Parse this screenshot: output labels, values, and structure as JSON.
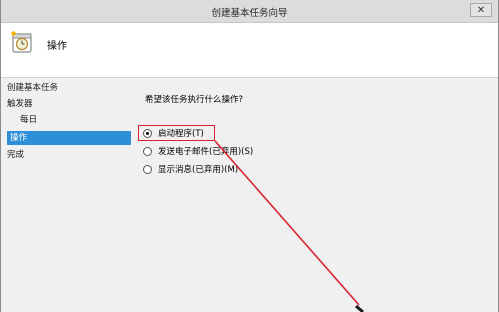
{
  "window": {
    "title": "创建基本任务向导",
    "close_label": "✕"
  },
  "header": {
    "title": "操作",
    "icon": "task-clock-icon"
  },
  "sidebar": {
    "items": [
      {
        "label": "创建基本任务",
        "selected": false
      },
      {
        "label": "触发器",
        "selected": false
      },
      {
        "label": "每日",
        "selected": false
      },
      {
        "label": "操作",
        "selected": true
      },
      {
        "label": "完成",
        "selected": false
      }
    ]
  },
  "content": {
    "question": "希望该任务执行什么操作?",
    "options": [
      {
        "label": "启动程序(T)",
        "checked": true
      },
      {
        "label": "发送电子邮件(已弃用)(S)",
        "checked": false
      },
      {
        "label": "显示消息(已弃用)(M)",
        "checked": false
      }
    ]
  },
  "annotation": {
    "color": "#d9232f",
    "shape": "red-arrow"
  }
}
